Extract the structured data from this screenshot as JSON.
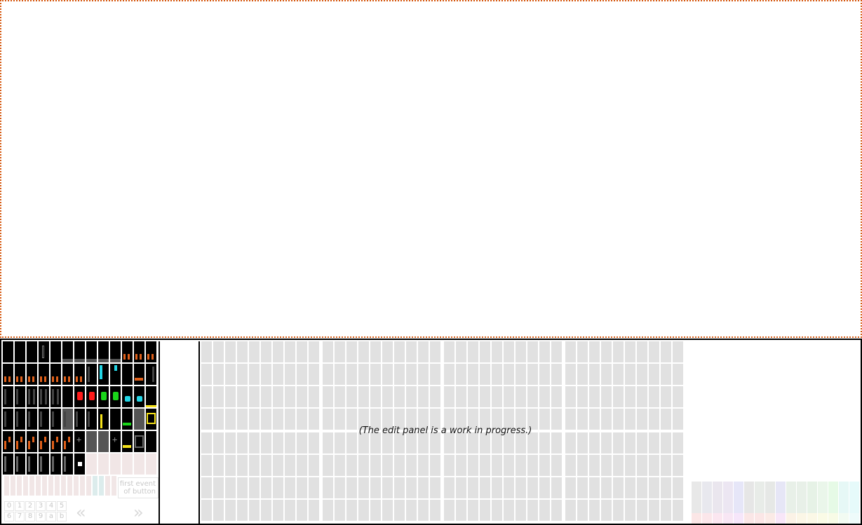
{
  "edit_panel": {
    "note": "(The edit panel is a work in progress.)"
  },
  "buttons": {
    "first_event_label_line1": "first event",
    "first_event_label_line2": "of button",
    "prev_icon": "double-chevron-left-icon",
    "next_icon": "double-chevron-right-icon"
  },
  "digits": [
    "0",
    "1",
    "2",
    "3",
    "4",
    "5",
    "6",
    "7",
    "8",
    "9",
    "a",
    "b"
  ],
  "colors": {
    "canvas_border": "#d65a12",
    "grid_cell": "#e1e1e1",
    "tile_bg": "#000000",
    "tile_orange": "#e0601a",
    "tile_cyan": "#23d6e6",
    "tile_red": "#ff1a1a",
    "tile_green": "#1ad61a",
    "tile_yellow": "#f5e21a"
  }
}
